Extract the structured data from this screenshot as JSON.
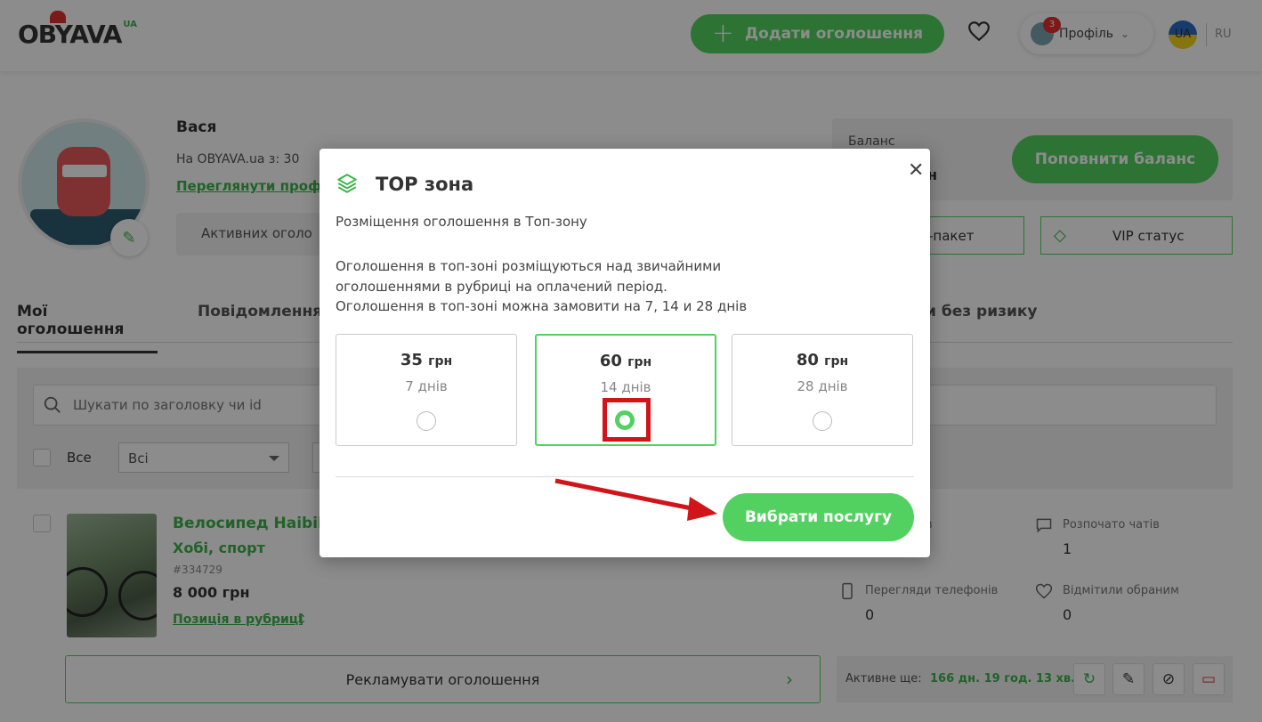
{
  "header": {
    "logo_text": "OBYAVA",
    "logo_suffix": "UA",
    "add_button": "Додати оголошення",
    "profile_label": "Профіль",
    "notification_count": "3",
    "lang_active": "UA",
    "lang_other": "RU"
  },
  "profile": {
    "name": "Вася",
    "since": "На OBYAVA.ua з: 30",
    "view_link": "Переглянути проф",
    "active_ads": "Активних оголо",
    "balance_label": "Баланс",
    "balance_value_fragment": "н",
    "topup_button": "Поповнити баланс",
    "package_button": "-пакет",
    "vip_button": "VIP статус"
  },
  "tabs": {
    "my_ads": "Мої оголошення",
    "messages": "Повідомлення",
    "no_risk": "и без ризику"
  },
  "filter": {
    "search_placeholder": "Шукати по заголовку чи id",
    "all_label": "Все",
    "select_value": "Всі"
  },
  "ad": {
    "title": "Велосипед Haibik",
    "category": "Хобі, спорт",
    "id": "#334729",
    "price": "8 000 грн",
    "position_link": "Позиція в рубриці",
    "promote_button": "Рекламувати оголошення",
    "active_label": "Активне ще:",
    "active_value": "166 дн. 19 год. 13 хв.",
    "stats": {
      "views_fragment": "в",
      "chats_label": "Розпочато чатів",
      "chats_value": "1",
      "phone_views_label": "Перегляди телефонів",
      "phone_views_value": "0",
      "favorites_label": "Відмітили обраним",
      "favorites_value": "0"
    }
  },
  "modal": {
    "title": "ТОР зона",
    "subtitle": "Розміщення оголошення в Топ-зону",
    "desc_line1": "Оголошення в топ-зоні розміщуються над звичайними",
    "desc_line2": "оголошеннями в рубриці на оплачений період.",
    "desc_line3": "Оголошення в топ-зоні можна замовити на 7, 14 и 28 днів",
    "options": [
      {
        "price": "35",
        "currency": "грн",
        "days": "7 днів"
      },
      {
        "price": "60",
        "currency": "грн",
        "days": "14 днів"
      },
      {
        "price": "80",
        "currency": "грн",
        "days": "28 днів"
      }
    ],
    "selected_option": "60 грн",
    "choose_button": "Вибрати послугу"
  },
  "colors": {
    "accent": "#52d160",
    "link": "#3cb34a",
    "highlight": "#d0141a"
  }
}
